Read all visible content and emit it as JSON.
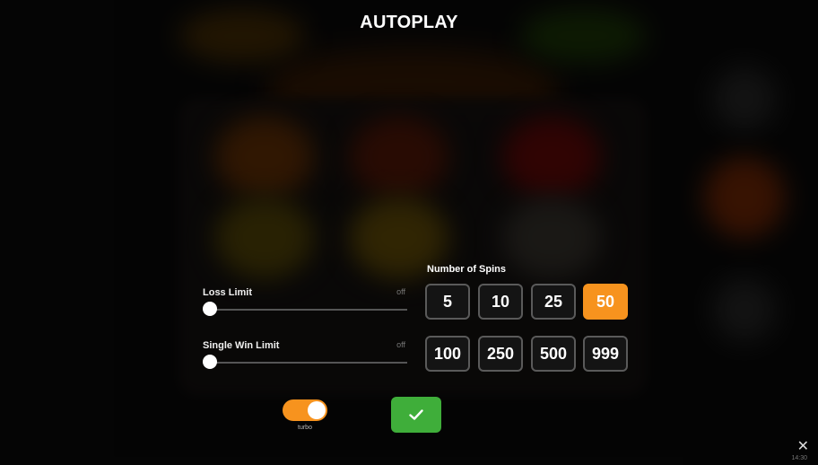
{
  "title": "AUTOPLAY",
  "loss_limit": {
    "label": "Loss Limit",
    "value": "off",
    "level": 0
  },
  "single_win_limit": {
    "label": "Single Win Limit",
    "value": "off",
    "level": 0
  },
  "spins": {
    "label": "Number of Spins",
    "options": [
      "5",
      "10",
      "25",
      "50",
      "100",
      "250",
      "500",
      "999"
    ],
    "selected": "50"
  },
  "toggle": {
    "label": "turbo",
    "on": true
  },
  "icons": {
    "confirm": "check-icon",
    "close": "close-icon"
  },
  "colors": {
    "accent": "#f7931e",
    "confirm": "#3fae3a"
  },
  "footer": {
    "time": "14:30"
  }
}
